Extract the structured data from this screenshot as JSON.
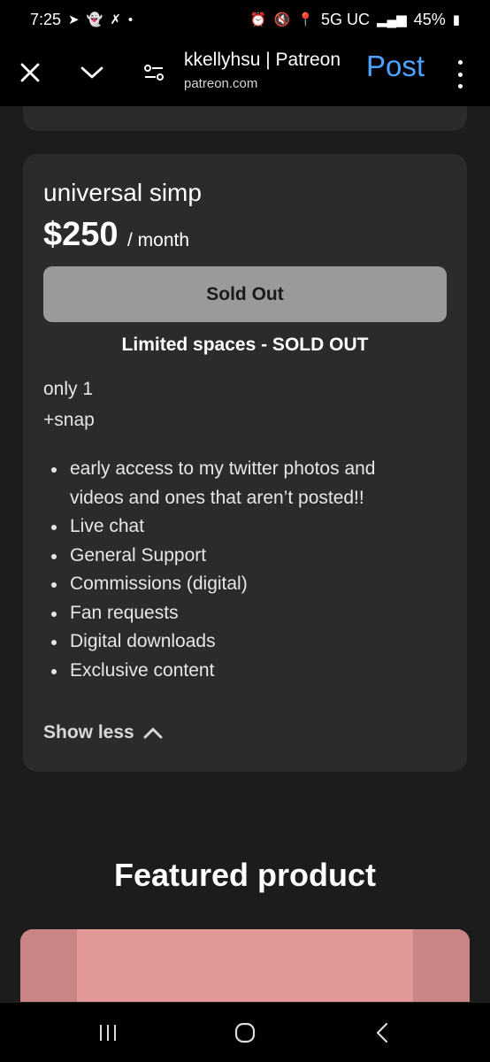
{
  "status_bar": {
    "time": "7:25",
    "network": "5G UC",
    "battery": "45%"
  },
  "toolbar": {
    "site_title": "kkellyhsu | Patreon",
    "site_url": "patreon.com",
    "post_label": "Post"
  },
  "tier": {
    "name": "universal simp",
    "price": "$250",
    "period": "/ month",
    "button_label": "Sold Out",
    "limited_text": "Limited spaces - SOLD OUT",
    "desc_lines": [
      "only 1",
      "+snap"
    ],
    "benefits": [
      "early access to my twitter photos and videos and ones that aren’t posted!!",
      "Live chat",
      "General Support",
      "Commissions (digital)",
      "Fan requests",
      "Digital downloads",
      "Exclusive content"
    ],
    "show_less_label": "Show less"
  },
  "featured": {
    "heading": "Featured product"
  },
  "colors": {
    "accent": "#4da3ff",
    "card_bg": "#2b2b2b",
    "page_bg": "#1c1c1c",
    "button_bg": "#9a9a9a"
  }
}
